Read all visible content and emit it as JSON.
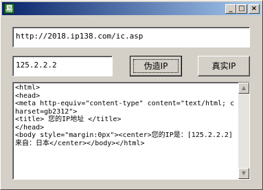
{
  "window": {
    "icon_label": "易",
    "min_glyph": "_",
    "max_glyph": "□",
    "close_glyph": "×"
  },
  "url_field": {
    "value": "http://2018.ip138.com/ic.asp"
  },
  "ip_field": {
    "value": "125.2.2.2"
  },
  "buttons": {
    "fake_ip": "伪造IP",
    "real_ip": "真实IP"
  },
  "output": {
    "text": "<html>\n<head>\n<meta http-equiv=\"content-type\" content=\"text/html; charset=gb2312\">\n<title> 您的IP地址 </title>\n</head>\n<body style=\"margin:0px\"><center>您的IP是：[125.2.2.2] 来自：日本</center></body></html>"
  },
  "scrollbar": {
    "up_glyph": "▲",
    "down_glyph": "▼"
  }
}
